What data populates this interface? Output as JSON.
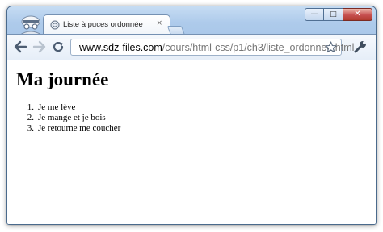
{
  "tab": {
    "title": "Liste à puces ordonnée",
    "close_glyph": "×"
  },
  "window_controls": {
    "minimize_glyph": "—",
    "maximize_glyph": "□",
    "close_glyph": "✕"
  },
  "address_bar": {
    "host": "www.sdz-files.com",
    "path": "/cours/html-css/p1/ch3/liste_ordonnee.html"
  },
  "page": {
    "title": "Ma journée",
    "items": [
      {
        "number": "1.",
        "text": "Je me lève"
      },
      {
        "number": "2.",
        "text": "Je mange et je bois"
      },
      {
        "number": "3.",
        "text": "Je retourne me coucher"
      }
    ]
  },
  "colors": {
    "frame": "#a3c2e6",
    "close_button": "#c75050",
    "url_path": "#767676"
  }
}
